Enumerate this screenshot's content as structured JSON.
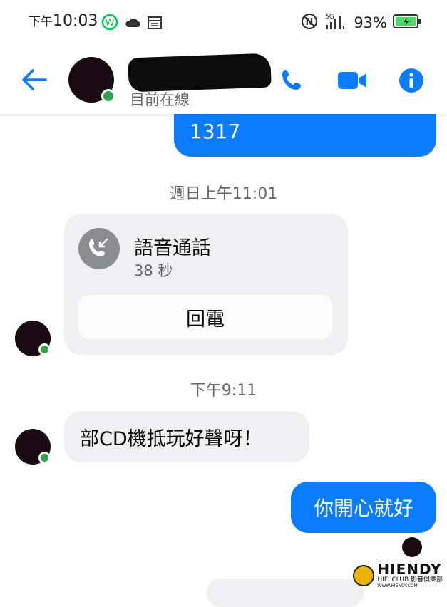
{
  "status_bar": {
    "time_prefix": "下午",
    "time": "10:03",
    "battery": "93%",
    "network": "5G"
  },
  "header": {
    "status": "目前在線",
    "icons": [
      "back-arrow-icon",
      "phone-icon",
      "video-icon",
      "info-icon"
    ]
  },
  "messages": {
    "top_outgoing_partial": "1317",
    "timestamp1": "週日上午11:01",
    "call": {
      "title": "語音通話",
      "duration": "38 秒",
      "callback_label": "回電"
    },
    "timestamp2": "下午9:11",
    "incoming_text": "部CD機抵玩好聲呀！",
    "outgoing_text": "你開心就好"
  },
  "watermark": {
    "brand": "HIENDY",
    "sub": "HIFI CLUB 影音俱樂部",
    "url": "WWW.HIENDY.COM"
  },
  "colors": {
    "accent": "#0a7cff",
    "online": "#31a24c",
    "incoming_bg": "#f0f0f2"
  }
}
